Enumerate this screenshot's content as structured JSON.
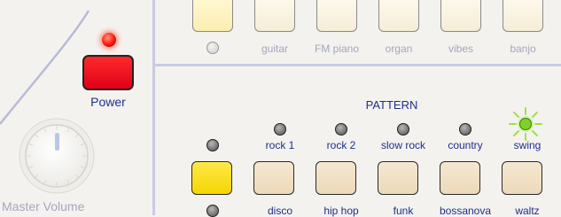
{
  "left_panel": {
    "power_label": "Power",
    "master_volume_label": "Master Volume"
  },
  "instruments": {
    "labels": [
      "guitar",
      "FM piano",
      "organ",
      "vibes",
      "banjo"
    ]
  },
  "pattern": {
    "title": "PATTERN",
    "upper_labels": [
      "rock 1",
      "rock 2",
      "slow rock",
      "country",
      "swing"
    ],
    "lower_labels": [
      "disco",
      "hip hop",
      "funk",
      "bossanova",
      "waltz"
    ],
    "active_upper": "swing"
  },
  "colors": {
    "label_blue": "#1e2f8c",
    "power_red": "#e0001a",
    "led_red": "#ff2a1a",
    "led_green": "#7fd12a",
    "yellow_button": "#f5d600"
  }
}
